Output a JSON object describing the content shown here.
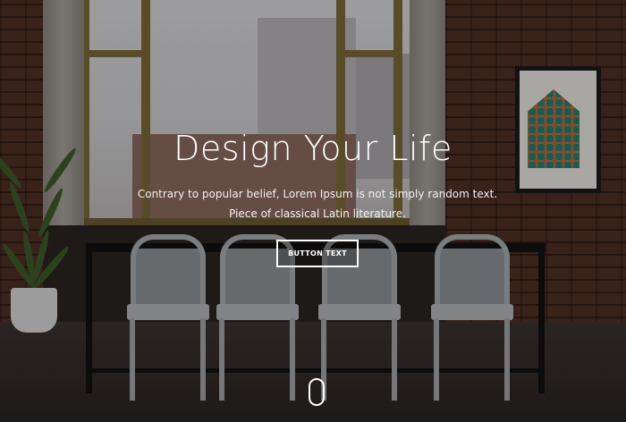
{
  "hero": {
    "title": "Design Your Life",
    "description": "Contrary to popular belief, Lorem Ipsum is not simply random text. Piece of classical Latin literature.",
    "button_label": "BUTTON TEXT"
  },
  "icons": {
    "scroll_indicator": "mouse-scroll-icon"
  },
  "colors": {
    "text": "#ffffff",
    "button_border": "#ffffff"
  }
}
